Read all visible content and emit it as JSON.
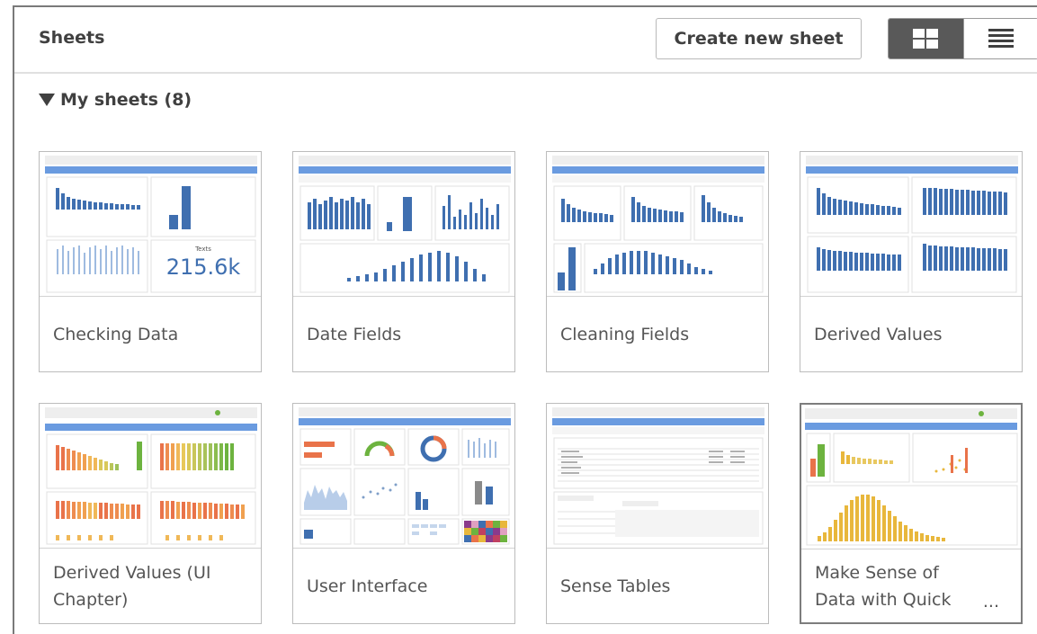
{
  "header": {
    "title": "Sheets",
    "create_label": "Create new sheet",
    "grid_view_icon": "grid-view-icon",
    "list_view_icon": "list-view-icon"
  },
  "section": {
    "label": "My sheets (8)",
    "icon": "caret-down-icon"
  },
  "sheets": [
    {
      "title": "Checking Data",
      "kpi_label": "Texts",
      "kpi_value": "215.6k"
    },
    {
      "title": "Date Fields"
    },
    {
      "title": "Cleaning Fields"
    },
    {
      "title": "Derived Values"
    },
    {
      "title": "Derived Values (UI Chapter)"
    },
    {
      "title": "User Interface"
    },
    {
      "title": "Sense Tables"
    },
    {
      "title": "Make Sense of Data with Quick",
      "truncated": "..."
    }
  ],
  "colors": {
    "accent_blue": "#4a7ab5",
    "header_bar": "#5b8fd3",
    "orange": "#e9734a",
    "green": "#6db33f",
    "yellow": "#e8b73c",
    "dark_toggle": "#595959"
  }
}
